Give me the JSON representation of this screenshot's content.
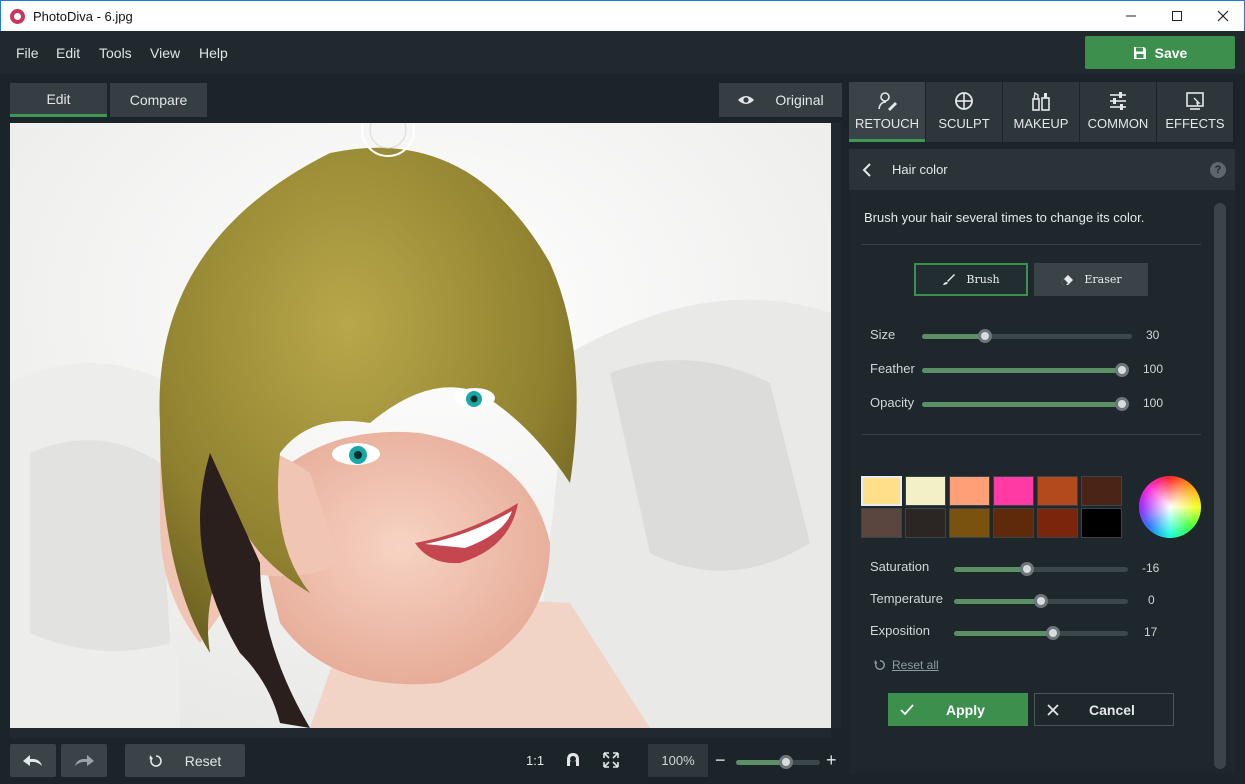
{
  "window": {
    "title": "PhotoDiva - 6.jpg"
  },
  "menu": [
    "File",
    "Edit",
    "Tools",
    "View",
    "Help"
  ],
  "save_label": "Save",
  "view_modes": {
    "edit": "Edit",
    "compare": "Compare",
    "original": "Original"
  },
  "tabs": [
    {
      "label": "RETOUCH",
      "icon": "retouch-icon",
      "active": true
    },
    {
      "label": "SCULPT",
      "icon": "sculpt-icon",
      "active": false
    },
    {
      "label": "MAKEUP",
      "icon": "makeup-icon",
      "active": false
    },
    {
      "label": "COMMON",
      "icon": "sliders-icon",
      "active": false
    },
    {
      "label": "EFFECTS",
      "icon": "effects-icon",
      "active": false
    }
  ],
  "panel": {
    "title": "Hair color",
    "help": "?",
    "hint": "Brush your hair several times to change its color.",
    "brush_label": "Brush",
    "eraser_label": "Eraser",
    "brush_sliders": [
      {
        "label": "Size",
        "value": "30",
        "fraction": 0.3
      },
      {
        "label": "Feather",
        "value": "100",
        "fraction": 1.0
      },
      {
        "label": "Opacity",
        "value": "100",
        "fraction": 1.0
      }
    ],
    "swatches": [
      "#ffe08a",
      "#f3efc6",
      "#ff9f78",
      "#ff3aa5",
      "#b34a1c",
      "#4a2415",
      "#5a463f",
      "#2b2624",
      "#7a520f",
      "#5e2a0a",
      "#7a250c",
      "#000000"
    ],
    "color_sliders": [
      {
        "label": "Saturation",
        "value": "-16",
        "fraction": 0.42
      },
      {
        "label": "Temperature",
        "value": "0",
        "fraction": 0.5
      },
      {
        "label": "Exposition",
        "value": "17",
        "fraction": 0.57
      }
    ],
    "reset_all": "Reset all",
    "apply": "Apply",
    "cancel": "Cancel"
  },
  "bottom": {
    "reset": "Reset",
    "one_to_one": "1:1",
    "zoom": "100%",
    "zoom_fraction": 0.6
  },
  "colors": {
    "accent": "#3c8f4c"
  }
}
